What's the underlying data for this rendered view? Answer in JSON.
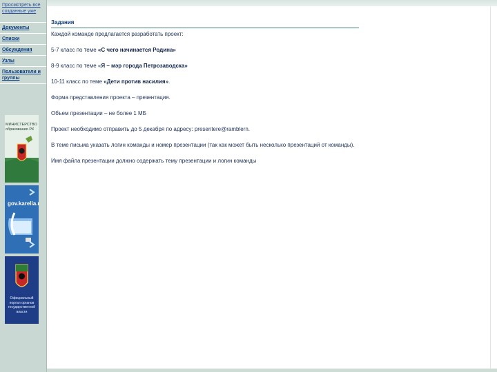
{
  "sidebar": {
    "items": [
      {
        "label": "Просмотреть все созданные уже"
      },
      {
        "label": "Документы"
      },
      {
        "label": "Списки"
      },
      {
        "label": "Обсуждения"
      },
      {
        "label": "Узлы"
      },
      {
        "label": "Пользователи и группы"
      }
    ],
    "banners": [
      {
        "label": "МИНИСТЕРСТВО образования РК"
      },
      {
        "label": "gov.karelia.ru"
      },
      {
        "label": "Официальный портал органов государственной власти"
      }
    ]
  },
  "main": {
    "title": "Задания",
    "paragraphs": [
      {
        "text": "Каждой команде предлагается разработать проект:"
      },
      {
        "prefix": "5-7 класс по теме ",
        "bold": "«С чего начинается Родина»",
        "suffix": ""
      },
      {
        "prefix": "8-9 класс по теме «",
        "bold": "Я – мэр города Петрозаводска»",
        "suffix": ""
      },
      {
        "prefix": "10-11 класс по теме ",
        "bold": "«Дети против насилия»",
        "suffix": "."
      },
      {
        "text": "Форма представления проекта – презентация."
      },
      {
        "text": "Объем презентации – не более 1 МБ"
      },
      {
        "text": "Проект необходимо отправить до 5 декабря по адресу: presentere@ramblern."
      },
      {
        "text": "В теме письма указать логин команды и номер презентации (так как может быть несколько презентаций от команды)."
      },
      {
        "text": "Имя файла презентации должно содержать тему презентации и логин команды"
      }
    ]
  },
  "colors": {
    "sidebar_bg": "#c9d8d2",
    "link": "#0b3b7a",
    "title_rule": "#3f7a72"
  }
}
